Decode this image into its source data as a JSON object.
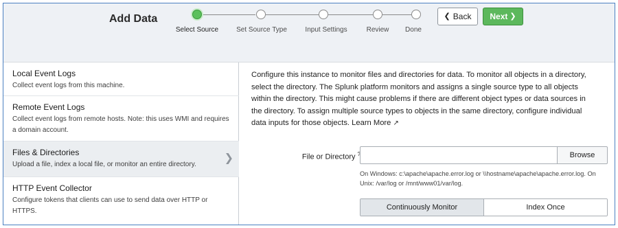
{
  "header": {
    "title": "Add Data",
    "steps": [
      {
        "label": "Select Source",
        "active": true
      },
      {
        "label": "Set Source Type",
        "active": false
      },
      {
        "label": "Input Settings",
        "active": false
      },
      {
        "label": "Review",
        "active": false
      },
      {
        "label": "Done",
        "active": false
      }
    ],
    "back_label": "Back",
    "next_label": "Next",
    "back_icon": "chevron-left-icon",
    "next_icon": "chevron-right-icon"
  },
  "sources": [
    {
      "name": "Local Event Logs",
      "description": "Collect event logs from this machine.",
      "selected": false
    },
    {
      "name": "Remote Event Logs",
      "description": "Collect event logs from remote hosts. Note: this uses WMI and requires a domain account.",
      "selected": false
    },
    {
      "name": "Files & Directories",
      "description": "Upload a file, index a local file, or monitor an entire directory.",
      "selected": true
    },
    {
      "name": "HTTP Event Collector",
      "description": "Configure tokens that clients can use to send data over HTTP or HTTPS.",
      "selected": false
    }
  ],
  "main": {
    "intro": "Configure this instance to monitor files and directories for data. To monitor all objects in a directory, select the directory. The Splunk platform monitors and assigns a single source type to all objects within the directory. This might cause problems if there are different object types or data sources in the directory. To assign multiple source types to objects in the same directory, configure individual data inputs for those objects.",
    "learn_more": "Learn More",
    "file_label": "File or Directory",
    "file_help_mark": "?",
    "file_value": "",
    "browse_label": "Browse",
    "hint": "On Windows: c:\\apache\\apache.error.log or \\\\hostname\\apache\\apache.error.log. On Unix: /var/log or /mnt/www01/var/log.",
    "modes": [
      {
        "label": "Continuously Monitor",
        "active": true
      },
      {
        "label": "Index Once",
        "active": false
      }
    ]
  },
  "colors": {
    "next_button": "#5cb85c",
    "active_step": "#5cc05c",
    "selected_row": "#ebeef1",
    "frame_border": "#4a7fc1"
  }
}
